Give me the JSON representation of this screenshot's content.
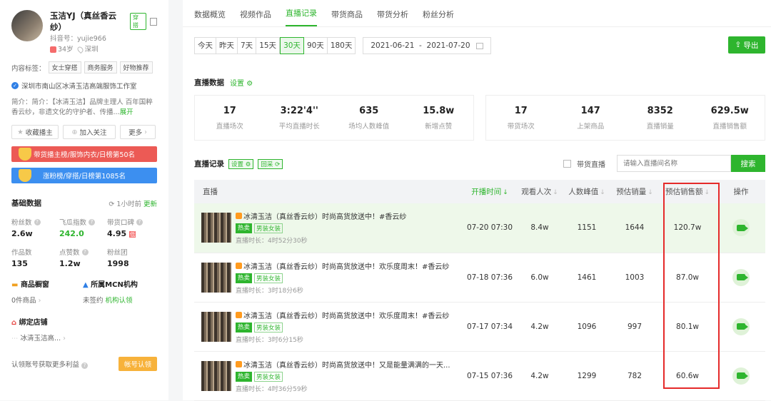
{
  "profile": {
    "name": "玉洁YJ（真丝香云纱）",
    "type_tag": "穿搭",
    "douyin_id": "抖音号：yujie966",
    "age": "34岁",
    "location": "深圳",
    "content_tags_label": "内容标签：",
    "content_tags": [
      "女士穿搭",
      "商务服务",
      "好物推荐"
    ],
    "org": "深圳市南山区冰清玉洁高端服饰工作室",
    "intro": "简介：简介：【冰清玉洁】品牌主理人 百年国粹香云纱，非遗文化的守护者、传播...",
    "intro_more": "展开",
    "btn_collect": "收藏播主",
    "btn_follow": "加入关注",
    "btn_more": "更多"
  },
  "ranks": [
    {
      "text": "带货播主榜/服饰内衣/日榜第50名",
      "color": "#ec5a55"
    },
    {
      "text": "涨粉榜/穿搭/日榜第1085名",
      "color": "#3c8ff0"
    }
  ],
  "basic": {
    "title": "基础数据",
    "updated": "1小时前",
    "update_link": "更新",
    "stats": [
      {
        "label": "粉丝数",
        "value": "2.6w",
        "color": "#222"
      },
      {
        "label": "飞瓜指数",
        "value": "242.0",
        "color": "#2eb52e"
      },
      {
        "label": "带货口碑",
        "value": "4.95",
        "color": "#222",
        "badge": "低"
      },
      {
        "label": "作品数",
        "value": "135",
        "color": "#222"
      },
      {
        "label": "点赞数",
        "value": "1.2w",
        "color": "#222"
      },
      {
        "label": "粉丝团",
        "value": "1998",
        "color": "#222"
      }
    ],
    "shop_title": "商品橱窗",
    "shop_value": "0件商品",
    "mcn_title": "所属MCN机构",
    "mcn_value": "未签约",
    "mcn_link": "机构认领",
    "store_title": "绑定店铺",
    "store_value": "冰清玉洁高...",
    "claim_text": "认领账号获取更多利益",
    "claim_btn": "帐号认领"
  },
  "tabs": [
    {
      "label": "数据概览",
      "active": false
    },
    {
      "label": "视频作品",
      "active": false
    },
    {
      "label": "直播记录",
      "active": true
    },
    {
      "label": "带货商品",
      "active": false
    },
    {
      "label": "带货分析",
      "active": false
    },
    {
      "label": "粉丝分析",
      "active": false
    }
  ],
  "periods": [
    {
      "label": "今天",
      "active": false
    },
    {
      "label": "昨天",
      "active": false
    },
    {
      "label": "7天",
      "active": false
    },
    {
      "label": "15天",
      "active": false
    },
    {
      "label": "30天",
      "active": true
    },
    {
      "label": "90天",
      "active": false
    },
    {
      "label": "180天",
      "active": false
    }
  ],
  "date_range": "2021-06-21  -  2021-07-20",
  "export_label": "导出",
  "live_data": {
    "title": "直播数据",
    "setting": "设置",
    "left_kpis": [
      {
        "value": "17",
        "label": "直播场次"
      },
      {
        "value": "3:22'4''",
        "label": "平均直播时长"
      },
      {
        "value": "635",
        "label": "场均人数峰值"
      },
      {
        "value": "15.8w",
        "label": "新增点赞"
      }
    ],
    "right_kpis": [
      {
        "value": "17",
        "label": "带货场次"
      },
      {
        "value": "147",
        "label": "上架商品"
      },
      {
        "value": "8352",
        "label": "直播销量"
      },
      {
        "value": "629.5w",
        "label": "直播销售额"
      }
    ]
  },
  "records": {
    "title": "直播记录",
    "tag_setting": "设置",
    "tag_replay": "回采",
    "checkbox_label": "带货直播",
    "search_placeholder": "请输入直播间名称",
    "search_btn": "搜索",
    "headers": {
      "live": "直播",
      "start": "开播时间",
      "views": "观看人次",
      "peak": "人数峰值",
      "sales": "预估销量",
      "revenue": "预估销售额",
      "op": "操作"
    },
    "rows": [
      {
        "title": "冰清玉洁（真丝香云纱）时尚高货放送中！#香云纱",
        "hot": "热卖",
        "cat": "男装女装",
        "duration": "直播时长：4时52分30秒",
        "start": "07-20 07:30",
        "views": "8.4w",
        "peak": "1151",
        "sales": "1644",
        "revenue": "120.7w"
      },
      {
        "title": "冰清玉洁（真丝香云纱）时尚高货放送中！欢乐度周末！#香云纱",
        "hot": "热卖",
        "cat": "男装女装",
        "duration": "直播时长：3时18分6秒",
        "start": "07-18 07:36",
        "views": "6.0w",
        "peak": "1461",
        "sales": "1003",
        "revenue": "87.0w"
      },
      {
        "title": "冰清玉洁（真丝香云纱）时尚高货放送中！欢乐度周末！#香云纱",
        "hot": "热卖",
        "cat": "男装女装",
        "duration": "直播时长：3时6分15秒",
        "start": "07-17 07:34",
        "views": "4.2w",
        "peak": "1096",
        "sales": "997",
        "revenue": "80.1w"
      },
      {
        "title": "冰清玉洁（真丝香云纱）时尚高货放送中！又是能量满满的一天...",
        "hot": "热卖",
        "cat": "男装女装",
        "duration": "直播时长：4时36分59秒",
        "start": "07-15 07:36",
        "views": "4.2w",
        "peak": "1299",
        "sales": "782",
        "revenue": "60.6w"
      }
    ]
  }
}
